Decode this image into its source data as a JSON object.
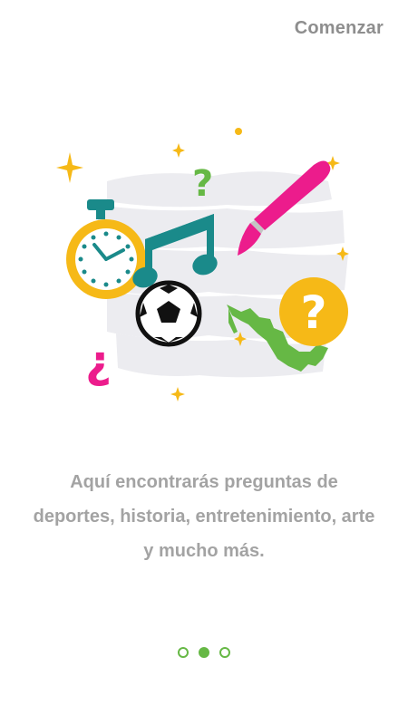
{
  "header": {
    "skip_label": "Comenzar"
  },
  "onboarding": {
    "message": "Aquí encontrarás preguntas de deportes, historia, entretenimiento, arte y mucho más.",
    "pages_total": 3,
    "current_page": 2
  },
  "illustration": {
    "icons": [
      "stopwatch-icon",
      "music-note-icon",
      "paintbrush-icon",
      "soccer-ball-icon",
      "mexico-map-icon",
      "question-mark-icon",
      "inverted-question-mark-icon",
      "sparkle-icon"
    ],
    "question_mark": "?",
    "inverted_question_mark": "¿"
  },
  "colors": {
    "accent_green": "#66b845",
    "text_gray": "#a3a3a3",
    "skip_gray": "#8e8e8e",
    "yellow": "#f6b917",
    "teal": "#1a8a8a",
    "pink": "#ec1c8c"
  }
}
